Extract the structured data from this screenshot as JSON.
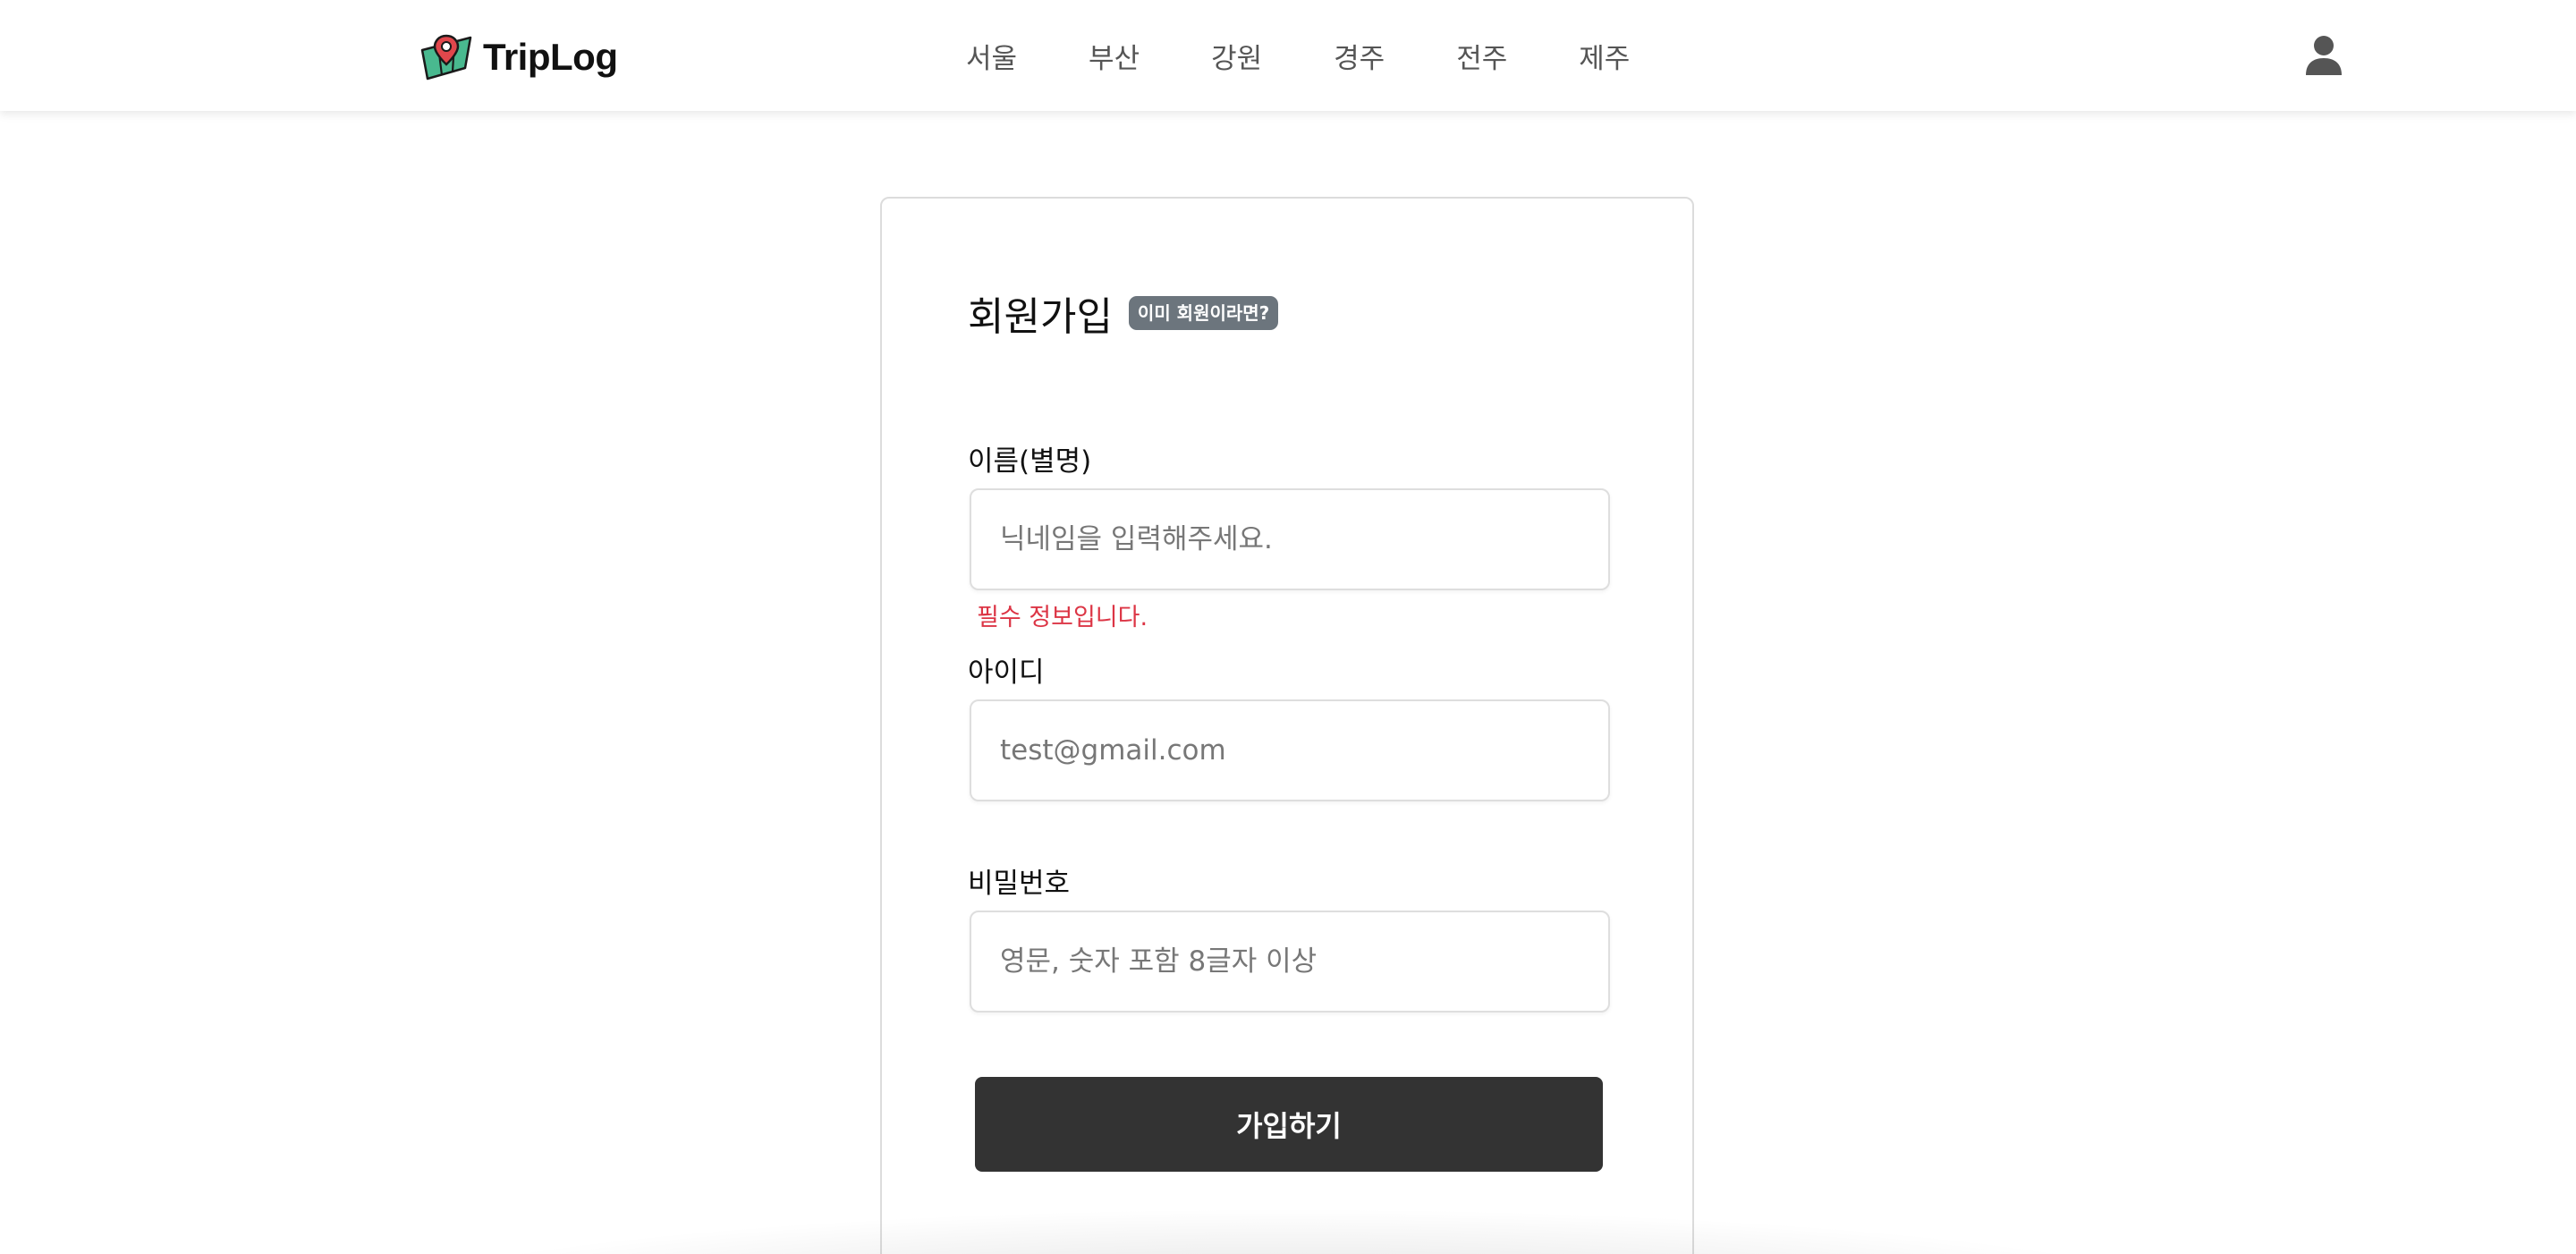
{
  "header": {
    "brand": {
      "name": "TripLog",
      "logo_icon": "map-pin-logo-icon"
    },
    "nav": [
      {
        "label": "서울"
      },
      {
        "label": "부산"
      },
      {
        "label": "강원"
      },
      {
        "label": "경주"
      },
      {
        "label": "전주"
      },
      {
        "label": "제주"
      }
    ],
    "user_icon": "user-icon"
  },
  "signup": {
    "title": "회원가입",
    "login_link": "이미 회원이라면?",
    "fields": {
      "name": {
        "label": "이름(별명)",
        "placeholder": "닉네임을 입력해주세요.",
        "value": "",
        "error": "필수 정보입니다."
      },
      "id": {
        "label": "아이디",
        "placeholder": "test@gmail.com",
        "value": ""
      },
      "password": {
        "label": "비밀번호",
        "placeholder": "영문, 숫자 포함 8글자 이상",
        "value": ""
      }
    },
    "submit_label": "가입하기"
  },
  "colors": {
    "error": "#dc3545",
    "button_bg": "#333333",
    "badge_bg": "#6c757d",
    "logo_red": "#e0474c",
    "logo_green": "#49b98f"
  }
}
